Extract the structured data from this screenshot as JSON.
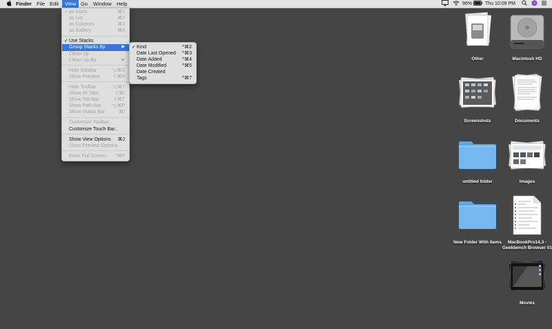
{
  "menubar": {
    "apple_icon": "apple-icon",
    "items": [
      "Finder",
      "File",
      "Edit",
      "View",
      "Go",
      "Window",
      "Help"
    ],
    "battery": "96%",
    "clock": "Thu 10:09 PM"
  },
  "view_menu": [
    {
      "label": "as Icons",
      "shortcut": "⌘1",
      "disabled": true,
      "checked": true
    },
    {
      "label": "as List",
      "shortcut": "⌘2",
      "disabled": true
    },
    {
      "label": "as Columns",
      "shortcut": "⌘3",
      "disabled": true
    },
    {
      "label": "as Gallery",
      "shortcut": "⌘4",
      "disabled": true
    },
    {
      "separator": true
    },
    {
      "label": "Use Stacks",
      "checked": true
    },
    {
      "label": "Group Stacks By",
      "submenu": true,
      "highlighted": true
    },
    {
      "label": "Clean Up",
      "disabled": true
    },
    {
      "label": "Clean Up By",
      "disabled": true,
      "submenu": true
    },
    {
      "separator": true
    },
    {
      "label": "Hide Sidebar",
      "shortcut": "⌥⌘S",
      "disabled": true
    },
    {
      "label": "Show Preview",
      "shortcut": "⇧⌘P",
      "disabled": true
    },
    {
      "separator": true
    },
    {
      "label": "Hide Toolbar",
      "shortcut": "⌥⌘T",
      "disabled": true
    },
    {
      "label": "Show All Tabs",
      "shortcut": "⇧⌘\\",
      "disabled": true
    },
    {
      "label": "Show Tab Bar",
      "shortcut": "⇧⌘T",
      "disabled": true
    },
    {
      "label": "Show Path Bar",
      "shortcut": "⌥⌘P",
      "disabled": true
    },
    {
      "label": "Show Status Bar",
      "shortcut": "⌘/",
      "disabled": true
    },
    {
      "separator": true
    },
    {
      "label": "Customize Toolbar...",
      "disabled": true
    },
    {
      "label": "Customize Touch Bar..."
    },
    {
      "separator": true
    },
    {
      "label": "Show View Options",
      "shortcut": "⌘J"
    },
    {
      "label": "Show Preview Options",
      "disabled": true
    },
    {
      "separator": true
    },
    {
      "label": "Enter Full Screen",
      "shortcut": "^⌘F",
      "disabled": true
    }
  ],
  "group_submenu": [
    {
      "label": "Kind",
      "shortcut": "^⌘2",
      "checked": true
    },
    {
      "label": "Date Last Opened",
      "shortcut": "^⌘3"
    },
    {
      "label": "Date Added",
      "shortcut": "^⌘4"
    },
    {
      "label": "Date Modified",
      "shortcut": "^⌘5"
    },
    {
      "label": "Date Created"
    },
    {
      "label": "Tags",
      "shortcut": "^⌘7"
    }
  ],
  "desktop": {
    "other": "Other",
    "macintosh_hd": "Macintosh HD",
    "screenshots": "Screenshots",
    "documents": "Documents",
    "untitled_folder": "untitled folder",
    "images": "Images",
    "new_folder": "New Folder With Items",
    "macbook": "MacBookPro14,3 - Geekbench Browser 01",
    "movies": "Movies"
  },
  "colors": {
    "accent": "#3a76d6",
    "desktop": "#454545",
    "folder": "#75b8ef"
  }
}
